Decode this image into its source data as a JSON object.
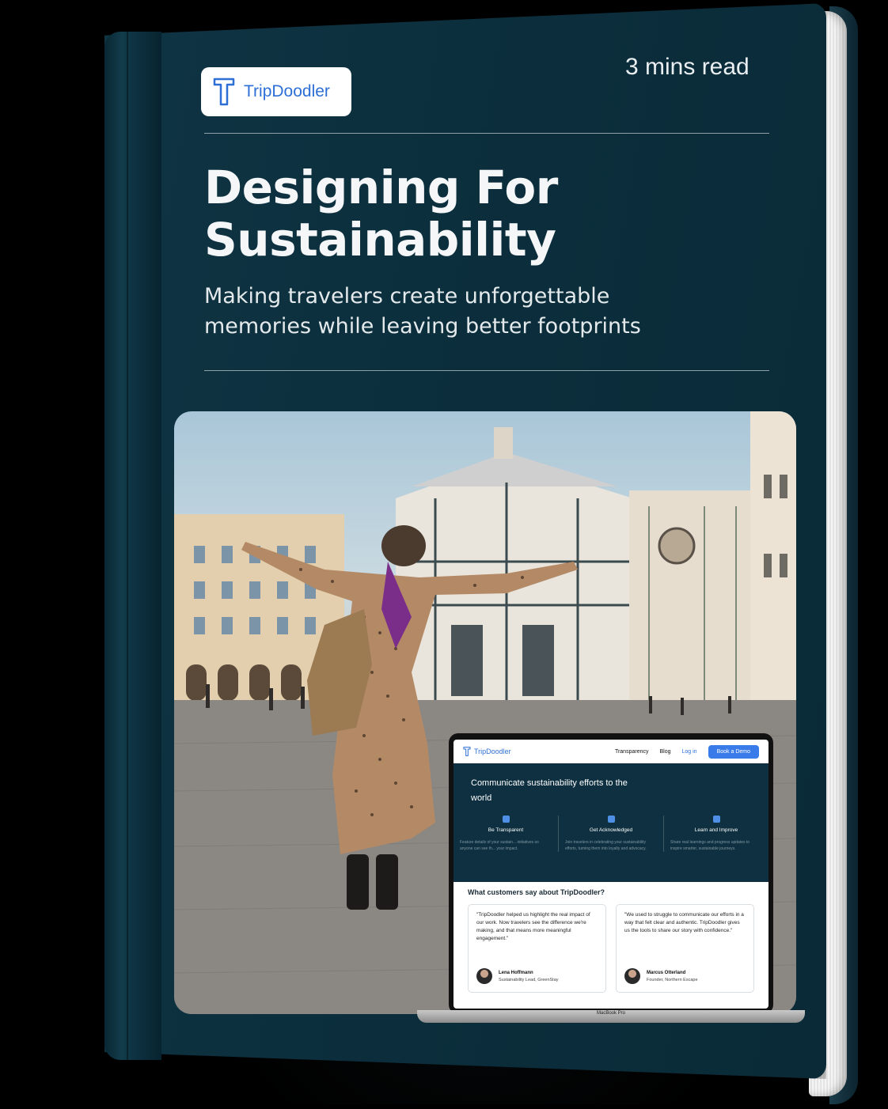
{
  "brand": {
    "name": "TripDoodler",
    "accent": "#2d6fd6",
    "cover_color": "#0c2f3d"
  },
  "cover": {
    "read_time": "3 mins read",
    "title": "Designing For Sustainability",
    "subtitle": "Making travelers create unforgettable memories while leaving better footprints"
  },
  "laptop": {
    "model_label": "MacBook Pro",
    "nav": {
      "logo": "TripDoodler",
      "links": [
        "Transparency",
        "Blog"
      ],
      "login": "Log in",
      "cta": "Book a Demo"
    },
    "hero": {
      "title": "Communicate sustainability efforts to the world",
      "features": [
        {
          "icon": "document-icon",
          "title": "Be Transparent",
          "desc": "Feature details of your sustain... initiatives so anyone can see th... your impact."
        },
        {
          "icon": "badge-icon",
          "title": "Get Acknowledged",
          "desc": "Join travelers in celebrating your sustainability efforts, turning them into loyalty and advocacy."
        },
        {
          "icon": "chart-icon",
          "title": "Learn and Improve",
          "desc": "Share real learnings and progress updates to inspire smarter, sustainable journeys."
        }
      ]
    },
    "testimonials": {
      "heading": "What customers say about TripDoodler?",
      "items": [
        {
          "quote": "\"TripDoodler helped us highlight the real impact of our work. Now travelers see the difference we're making, and that means more meaningful engagement.\"",
          "name": "Lena Hoffmann",
          "role": "Sustainability Lead, GreenStay"
        },
        {
          "quote": "\"We used to struggle to communicate our efforts in a way that felt clear and authentic. TripDoodler gives us the tools to share our story with confidence.\"",
          "name": "Marcus Otterland",
          "role": "Founder, Northern Escape"
        }
      ]
    }
  }
}
